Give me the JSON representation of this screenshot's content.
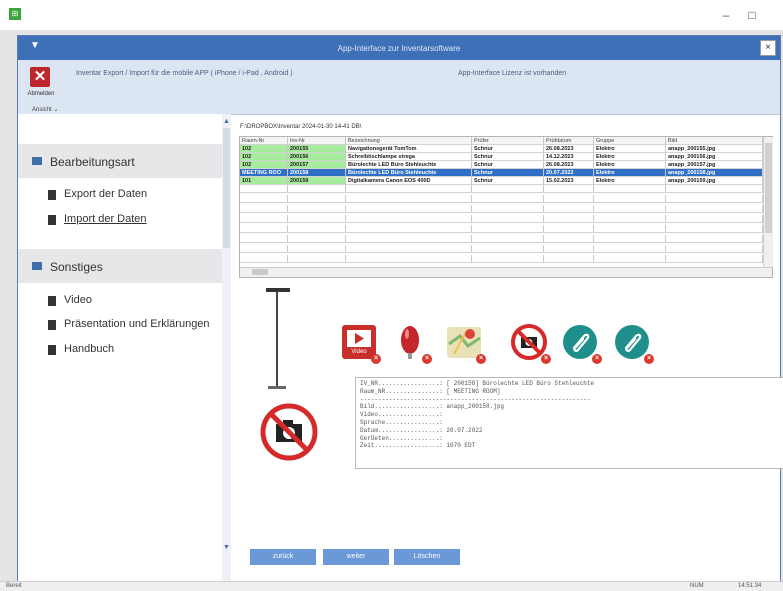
{
  "outer_window": {
    "controls": {
      "minimize": "–",
      "maximize": "□"
    }
  },
  "inner_window": {
    "title": "App-Interface zur Inventarsoftware",
    "menu_glyph": "▼",
    "close_glyph": "×"
  },
  "ribbon": {
    "abmelden_label": "Abmelden",
    "abmelden_glyph": "✕",
    "ansicht_label": "Ansicht ⌄",
    "info": "Inventar Export / Import für die mobile APP ( iPhone / i-Pad , Android )",
    "license": "App-Interface Lizenz ist vorhanden"
  },
  "left_panel": {
    "section1": {
      "title": "Bearbeitungsart",
      "items": [
        "Export der Daten",
        "Import der Daten"
      ]
    },
    "section2": {
      "title": "Sonstiges",
      "items": [
        "Video",
        "Präsentation und Erklärungen",
        "Handbuch"
      ]
    }
  },
  "path": "F:\\DROPBOX\\Inventar 2024-01-30 14-41 DB\\",
  "grid": {
    "columns": [
      "Raum-Nr",
      "Inv-Nr",
      "Bezeichnung",
      "Prüfer",
      "Prüfdatum",
      "Gruppe",
      "Bild"
    ],
    "rows": [
      {
        "style": "green",
        "cells": [
          "102",
          "200155",
          "Navigationsgerät TomTom",
          "Schnur",
          "26.08.2023",
          "Elektro",
          "anapp_200155.jpg"
        ]
      },
      {
        "style": "green",
        "cells": [
          "102",
          "200156",
          "Schreibtischlampe strega",
          "Schnur",
          "14.12.2023",
          "Elektro",
          "anapp_200156.jpg"
        ]
      },
      {
        "style": "green",
        "cells": [
          "102",
          "200157",
          "Bürolechte LED Büro Stehleuchte",
          "Schnur",
          "26.08.2023",
          "Elektro",
          "anapp_200157.jpg"
        ]
      },
      {
        "style": "selected",
        "cells": [
          "MEETING ROO",
          "200158",
          "Bürolechte LED Büro Stehleuchte",
          "Schnur",
          "20.07.2022",
          "Elektro",
          "anapp_200158.jpg"
        ]
      },
      {
        "style": "green",
        "cells": [
          "101",
          "200159",
          "Digitalkamera Canon EOS 400D",
          "Schnur",
          "15.02.2023",
          "Elektro",
          "anapp_200159.jpg"
        ]
      }
    ],
    "empty_rows": 8
  },
  "media_icons": [
    {
      "name": "video-icon",
      "label": "Video"
    },
    {
      "name": "microphone-icon",
      "label": ""
    },
    {
      "name": "map-icon",
      "label": ""
    },
    {
      "name": "no-photo-icon",
      "label": ""
    },
    {
      "name": "paperclip-icon",
      "label": ""
    },
    {
      "name": "paperclip-icon",
      "label": ""
    }
  ],
  "details_text": "IV_NR.................: [ 200158] Bürolechte LED Büro Stehleuchte\nRaum_NR...............: [ MEETING ROOM]\n----------------------------------------------------------------\nBild..................: anapp_200158.jpg\nVideo.................:\nSprache...............:\nDatum.................: 20.07.2022\nGerÜeten..............:\nZeit..................: 1070 EDT",
  "buttons": {
    "back": "zurück",
    "next": "weiter",
    "delete": "Löschen"
  },
  "status": {
    "left": "Bereit",
    "right1": "NUM",
    "right2": "14:51:34"
  },
  "colors": {
    "accent": "#3e70b8",
    "selected_row": "#2f6fc5",
    "green_row": "#a7eb9e",
    "button": "#6b98d6",
    "delete_badge": "#d93a2d"
  }
}
